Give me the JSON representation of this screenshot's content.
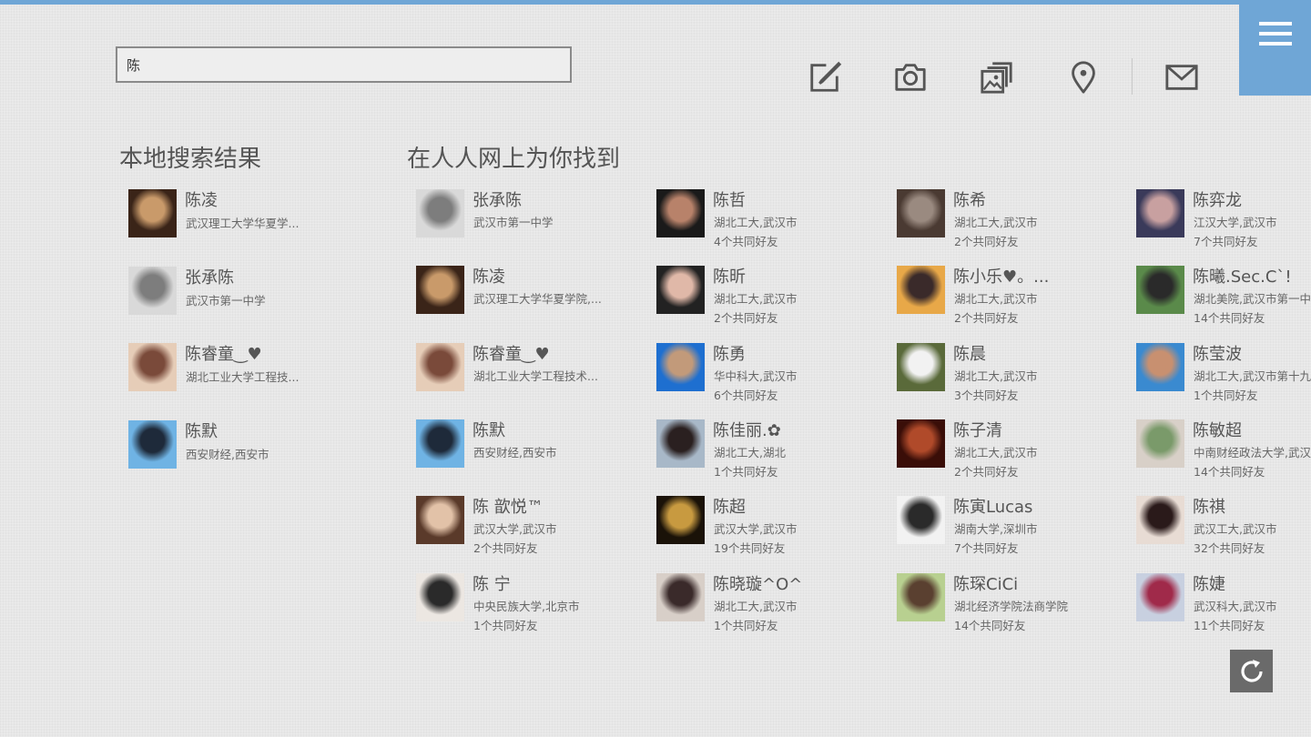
{
  "search": {
    "value": "陈"
  },
  "toolbar": [
    "edit-icon",
    "camera-icon",
    "photos-icon",
    "location-icon",
    "mail-icon"
  ],
  "menu": {
    "icon": "menu-icon"
  },
  "local": {
    "title": "本地搜索结果",
    "results": [
      {
        "name": "陈凌",
        "org": "武汉理工大学华夏学...",
        "avatar": [
          "#3a2418",
          "#c99a6a"
        ]
      },
      {
        "name": "张承陈",
        "org": "武汉市第一中学",
        "avatar": [
          "#d9d9d9",
          "#7d7d7d"
        ]
      },
      {
        "name": "陈睿童‿♥",
        "org": "湖北工业大学工程技...",
        "avatar": [
          "#e6cdb8",
          "#7a4a3a"
        ]
      },
      {
        "name": "陈默",
        "org": "西安财经,西安市",
        "avatar": [
          "#6fb3e4",
          "#1e2a3a"
        ]
      }
    ]
  },
  "online": {
    "title": "在人人网上为你找到",
    "results": [
      {
        "name": "张承陈",
        "org": "武汉市第一中学",
        "mutual": "",
        "avatar": [
          "#d9d9d9",
          "#7d7d7d"
        ]
      },
      {
        "name": "陈凌",
        "org": "武汉理工大学华夏学院,...",
        "mutual": "",
        "avatar": [
          "#3a2418",
          "#c99a6a"
        ]
      },
      {
        "name": "陈睿童‿♥",
        "org": "湖北工业大学工程技术...",
        "mutual": "",
        "avatar": [
          "#e6cdb8",
          "#7a4a3a"
        ]
      },
      {
        "name": "陈默",
        "org": "西安财经,西安市",
        "mutual": "",
        "avatar": [
          "#6fb3e4",
          "#1e2a3a"
        ]
      },
      {
        "name": "陈 歆悦™",
        "org": "武汉大学,武汉市",
        "mutual": "2个共同好友",
        "avatar": [
          "#5a3a2a",
          "#e2c2a8"
        ]
      },
      {
        "name": "陈 宁",
        "org": "中央民族大学,北京市",
        "mutual": "1个共同好友",
        "avatar": [
          "#ece7e2",
          "#2a2a2a"
        ]
      },
      {
        "name": "陈哲",
        "org": "湖北工大,武汉市",
        "mutual": "4个共同好友",
        "avatar": [
          "#1a1a1a",
          "#b8826a"
        ]
      },
      {
        "name": "陈昕",
        "org": "湖北工大,武汉市",
        "mutual": "2个共同好友",
        "avatar": [
          "#222222",
          "#e0b8a8"
        ]
      },
      {
        "name": "陈勇",
        "org": "华中科大,武汉市",
        "mutual": "6个共同好友",
        "avatar": [
          "#1e6fd0",
          "#c29a7a"
        ]
      },
      {
        "name": "陈佳丽.✿",
        "org": "湖北工大,湖北",
        "mutual": "1个共同好友",
        "avatar": [
          "#a8b8c8",
          "#2a2020"
        ]
      },
      {
        "name": "陈超",
        "org": "武汉大学,武汉市",
        "mutual": "19个共同好友",
        "avatar": [
          "#1a1208",
          "#c89a40"
        ]
      },
      {
        "name": "陈晓璇^O^",
        "org": "湖北工大,武汉市",
        "mutual": "1个共同好友",
        "avatar": [
          "#d8cfc8",
          "#3a2a2a"
        ]
      },
      {
        "name": "陈希",
        "org": "湖北工大,武汉市",
        "mutual": "2个共同好友",
        "avatar": [
          "#4a3a32",
          "#9a8a80"
        ]
      },
      {
        "name": "陈小乐♥。...",
        "org": "湖北工大,武汉市",
        "mutual": "2个共同好友",
        "avatar": [
          "#e8a848",
          "#3a2a2a"
        ]
      },
      {
        "name": "陈晨",
        "org": "湖北工大,武汉市",
        "mutual": "3个共同好友",
        "avatar": [
          "#5a6a3a",
          "#f2f2f2"
        ]
      },
      {
        "name": "陈子清",
        "org": "湖北工大,武汉市",
        "mutual": "2个共同好友",
        "avatar": [
          "#3a0e08",
          "#b04a2a"
        ]
      },
      {
        "name": "陈寅Lucas",
        "org": "湖南大学,深圳市",
        "mutual": "7个共同好友",
        "avatar": [
          "#f2f2f2",
          "#2a2a2a"
        ]
      },
      {
        "name": "陈琛CiCi",
        "org": "湖北经济学院法商学院",
        "mutual": "14个共同好友",
        "avatar": [
          "#b8d090",
          "#5a4030"
        ]
      },
      {
        "name": "陈弈龙",
        "org": "江汉大学,武汉市",
        "mutual": "7个共同好友",
        "avatar": [
          "#3a3a5a",
          "#c8a0a0"
        ]
      },
      {
        "name": "陈曦.Sec.C`!",
        "org": "湖北美院,武汉市第一中",
        "mutual": "14个共同好友",
        "avatar": [
          "#5a8a4a",
          "#2a2a2a"
        ]
      },
      {
        "name": "陈莹波",
        "org": "湖北工大,武汉市第十九",
        "mutual": "1个共同好友",
        "avatar": [
          "#3a8ad0",
          "#c89070"
        ]
      },
      {
        "name": "陈敏超",
        "org": "中南财经政法大学,武汉",
        "mutual": "14个共同好友",
        "avatar": [
          "#d8d0c8",
          "#7a9a6a"
        ]
      },
      {
        "name": "陈祺",
        "org": "武汉工大,武汉市",
        "mutual": "32个共同好友",
        "avatar": [
          "#e8dcd4",
          "#2a1a1a"
        ]
      },
      {
        "name": "陈婕",
        "org": "武汉科大,武汉市",
        "mutual": "11个共同好友",
        "avatar": [
          "#c8d0e0",
          "#a02a4a"
        ]
      }
    ]
  },
  "refresh": {
    "icon": "refresh-icon"
  }
}
